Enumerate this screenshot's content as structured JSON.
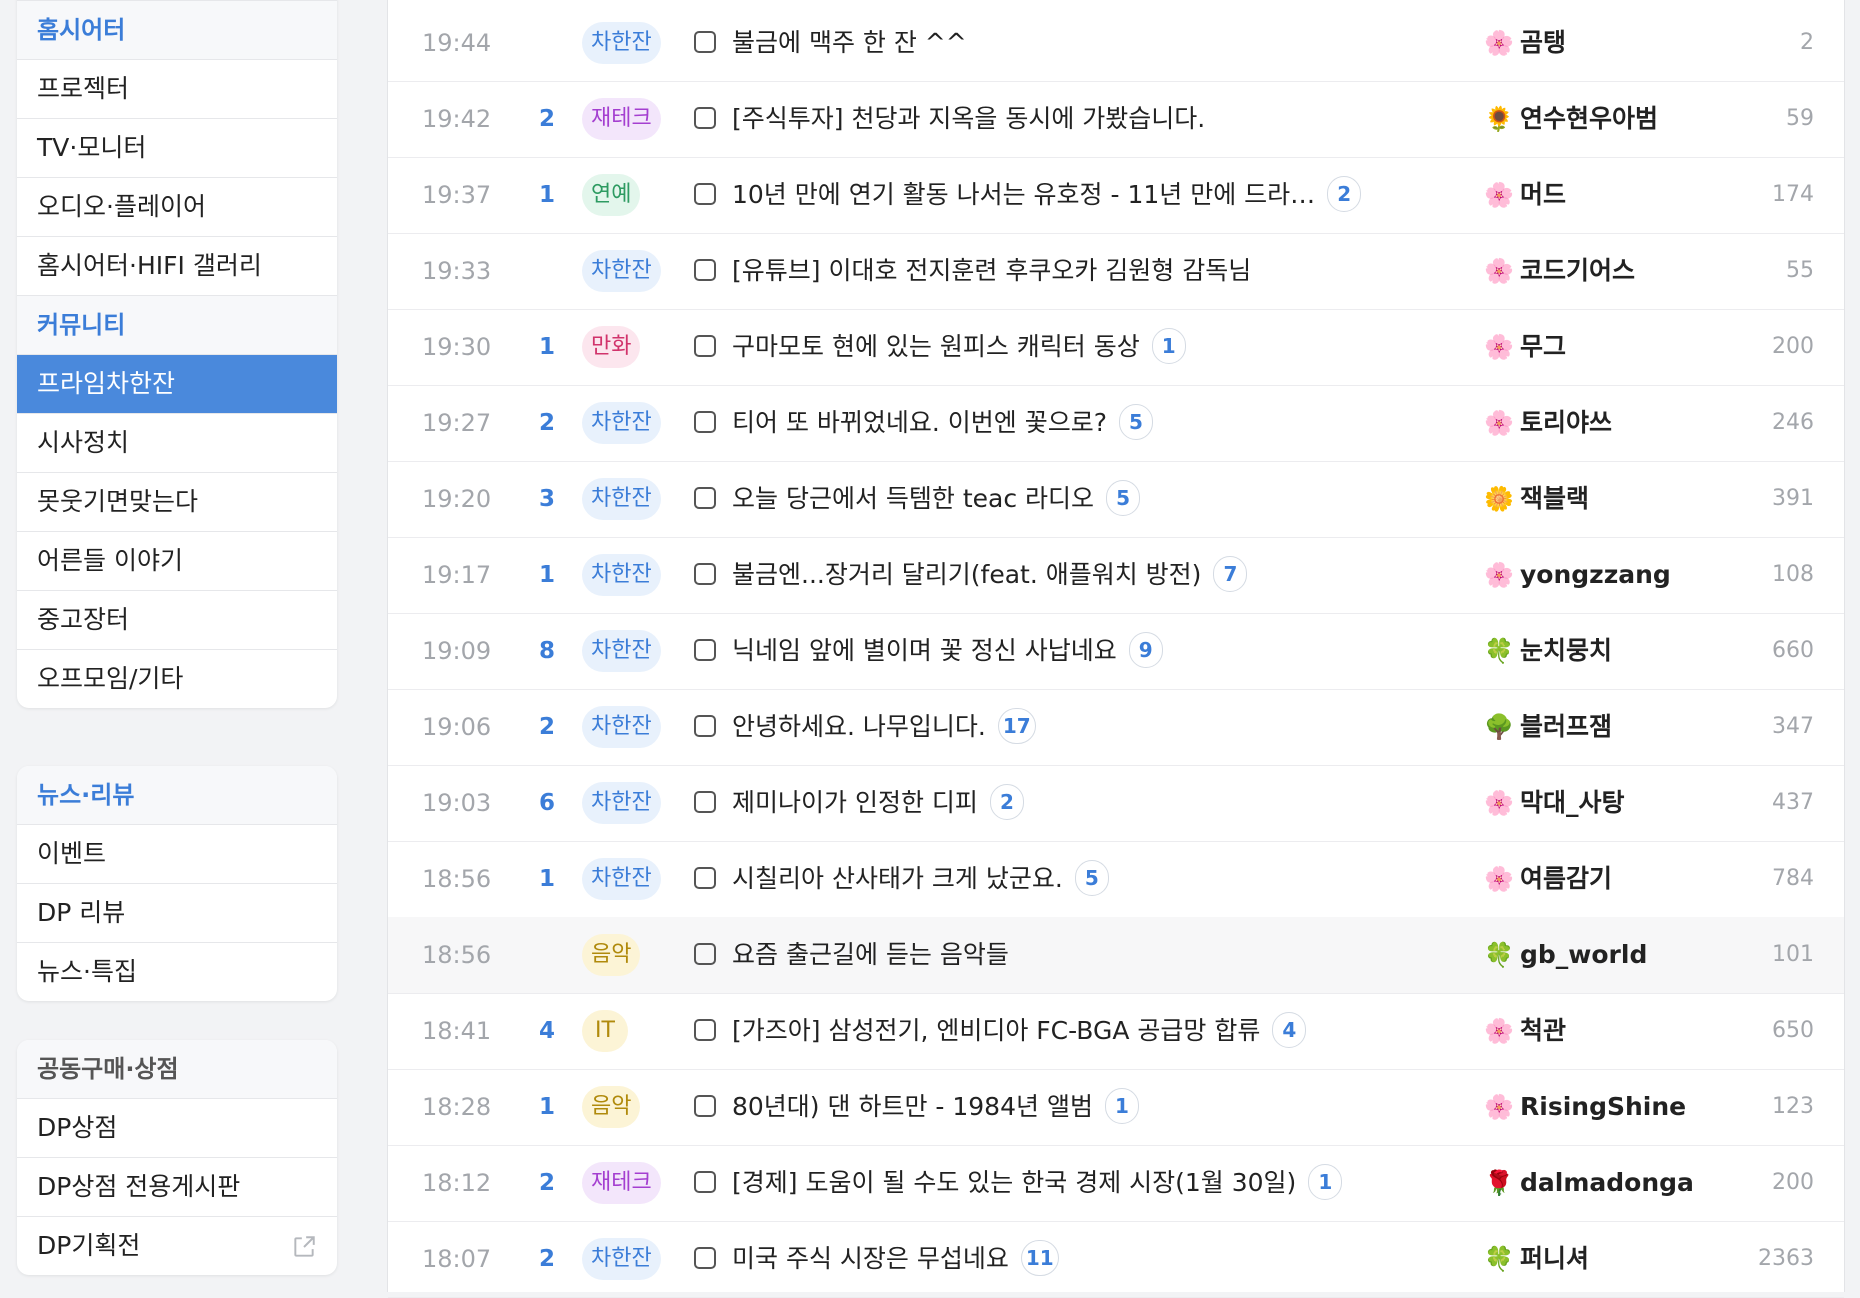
{
  "sidebar": {
    "group1": {
      "header_home": "홈시어터",
      "home_items": [
        "프로젝터",
        "TV·모니터",
        "오디오·플레이어",
        "홈시어터·HIFI 갤러리"
      ],
      "header_community": "커뮤니티",
      "community_items": [
        "프라임차한잔",
        "시사정치",
        "못웃기면맞는다",
        "어른들 이야기",
        "중고장터",
        "오프모임/기타"
      ]
    },
    "group2": {
      "header": "뉴스·리뷰",
      "items": [
        "이벤트",
        "DP 리뷰",
        "뉴스·특집"
      ]
    },
    "group3": {
      "header": "공동구매·상점",
      "items": [
        "DP상점",
        "DP상점 전용게시판",
        "DP기획전"
      ]
    }
  },
  "tag_colors": {
    "차한잔": {
      "bg": "#e8f1fc",
      "fg": "#3b7dd8"
    },
    "재테크": {
      "bg": "#f3e6fb",
      "fg": "#a43fd0"
    },
    "연예": {
      "bg": "#e3f6ec",
      "fg": "#2e9b62"
    },
    "만화": {
      "bg": "#fce6ee",
      "fg": "#d1336b"
    },
    "음악": {
      "bg": "#fcf4d6",
      "fg": "#b08a0c"
    },
    "IT": {
      "bg": "#fcf4d6",
      "fg": "#b08a0c"
    }
  },
  "posts": [
    {
      "time": "19:44",
      "count": "",
      "tag": "차한잔",
      "title": "불금에 맥주 한 잔 ^^",
      "comments": "",
      "user_icon": "lotus-icon",
      "user": "곰탱",
      "views": "2"
    },
    {
      "time": "19:42",
      "count": "2",
      "tag": "재테크",
      "title": "[주식투자] 천당과 지옥을 동시에 가봤습니다.",
      "comments": "",
      "user_icon": "sunflower-icon",
      "user": "연수현우아범",
      "views": "59"
    },
    {
      "time": "19:37",
      "count": "1",
      "tag": "연예",
      "title": "10년 만에 연기 활동 나서는 유호정 - 11년 만에 드라…",
      "comments": "2",
      "user_icon": "lotus-icon",
      "user": "머드",
      "views": "174"
    },
    {
      "time": "19:33",
      "count": "",
      "tag": "차한잔",
      "title": "[유튜브] 이대호 전지훈련 후쿠오카 김원형 감독님",
      "comments": "",
      "user_icon": "lotus-icon",
      "user": "코드기어스",
      "views": "55"
    },
    {
      "time": "19:30",
      "count": "1",
      "tag": "만화",
      "title": "구마모토 현에 있는 원피스 캐릭터 동상",
      "comments": "1",
      "user_icon": "lotus-icon",
      "user": "무그",
      "views": "200"
    },
    {
      "time": "19:27",
      "count": "2",
      "tag": "차한잔",
      "title": "티어 또 바뀌었네요. 이번엔 꽃으로?",
      "comments": "5",
      "user_icon": "lotus-icon",
      "user": "토리야쓰",
      "views": "246"
    },
    {
      "time": "19:20",
      "count": "3",
      "tag": "차한잔",
      "title": "오늘 당근에서 득템한 teac 라디오",
      "comments": "5",
      "user_icon": "blossom-icon",
      "user": "잭블랙",
      "views": "391"
    },
    {
      "time": "19:17",
      "count": "1",
      "tag": "차한잔",
      "title": "불금엔...장거리 달리기(feat. 애플워치 방전)",
      "comments": "7",
      "user_icon": "lotus-icon",
      "user": "yongzzang",
      "views": "108"
    },
    {
      "time": "19:09",
      "count": "8",
      "tag": "차한잔",
      "title": "닉네임 앞에 별이며 꽃 정신 사납네요",
      "comments": "9",
      "user_icon": "clover-icon",
      "user": "눈치뭉치",
      "views": "660"
    },
    {
      "time": "19:06",
      "count": "2",
      "tag": "차한잔",
      "title": "안녕하세요. 나무입니다.",
      "comments": "17",
      "user_icon": "tree-icon",
      "user": "블러프잼",
      "views": "347"
    },
    {
      "time": "19:03",
      "count": "6",
      "tag": "차한잔",
      "title": "제미나이가 인정한 디피",
      "comments": "2",
      "user_icon": "lotus-icon",
      "user": "막대_사탕",
      "views": "437"
    },
    {
      "time": "18:56",
      "count": "1",
      "tag": "차한잔",
      "title": "시칠리아 산사태가 크게 났군요.",
      "comments": "5",
      "user_icon": "lotus-icon",
      "user": "여름감기",
      "views": "784"
    },
    {
      "time": "18:56",
      "count": "",
      "tag": "음악",
      "title": "요즘 출근길에 듣는 음악들",
      "comments": "",
      "user_icon": "clover-icon",
      "user": "gb_world",
      "views": "101"
    },
    {
      "time": "18:41",
      "count": "4",
      "tag": "IT",
      "title": "[가즈아] 삼성전기, 엔비디아 FC-BGA 공급망 합류",
      "comments": "4",
      "user_icon": "lotus-icon",
      "user": "척관",
      "views": "650"
    },
    {
      "time": "18:28",
      "count": "1",
      "tag": "음악",
      "title": "80년대) 댄 하트만 - 1984년 앨범",
      "comments": "1",
      "user_icon": "lotus-icon",
      "user": "RisingShine",
      "views": "123"
    },
    {
      "time": "18:12",
      "count": "2",
      "tag": "재테크",
      "title": "[경제] 도움이 될 수도 있는 한국 경제 시장(1월 30일)",
      "comments": "1",
      "user_icon": "rose-icon",
      "user": "dalmadonga",
      "views": "200"
    },
    {
      "time": "18:07",
      "count": "2",
      "tag": "차한잔",
      "title": "미국 주식 시장은 무섭네요",
      "comments": "11",
      "user_icon": "clover-icon",
      "user": "퍼니셔",
      "views": "2363"
    }
  ],
  "icon_glyphs": {
    "lotus-icon": "🌸",
    "sunflower-icon": "🌻",
    "blossom-icon": "🌼",
    "clover-icon": "🍀",
    "tree-icon": "🌳",
    "rose-icon": "🌹"
  },
  "icon_colors": {
    "lotus-icon": "#e0607a",
    "sunflower-icon": "#e5a400",
    "blossom-icon": "#f0b400",
    "clover-icon": "#3aa34a",
    "tree-icon": "#2f7d32",
    "rose-icon": "#c81e2e"
  },
  "highlighted_row": 12
}
